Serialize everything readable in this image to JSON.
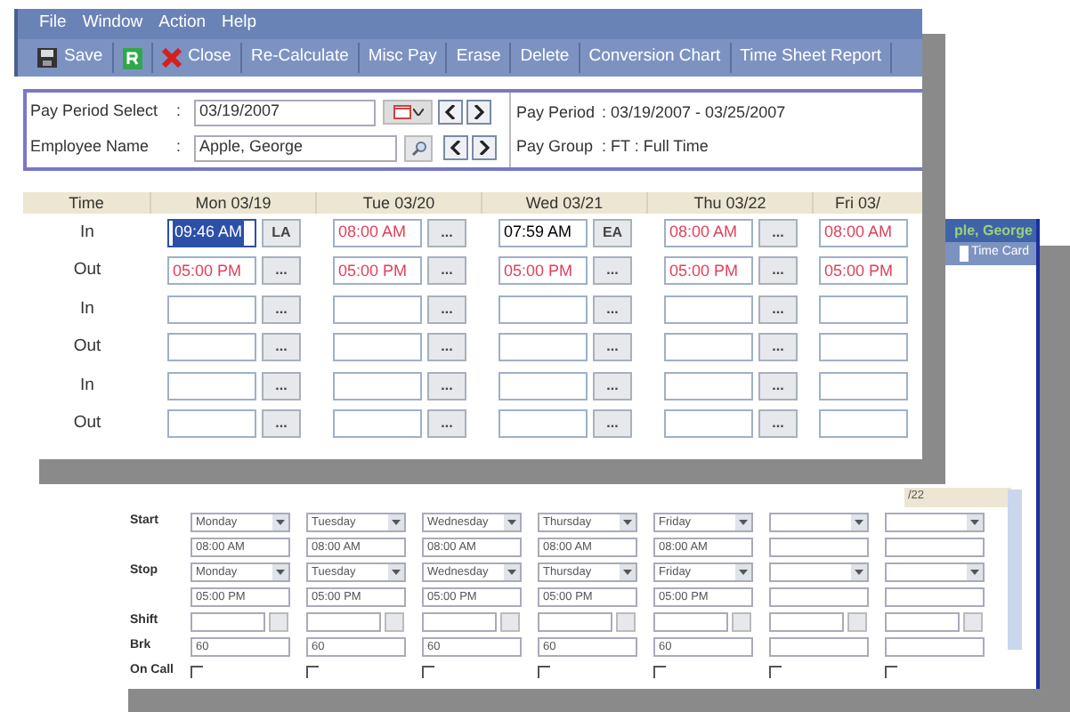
{
  "front_window": {
    "menu": [
      "File",
      "Window",
      "Action",
      "Help"
    ],
    "toolbar": [
      {
        "kind": "save",
        "label": "Save"
      },
      {
        "kind": "refresh"
      },
      {
        "kind": "close",
        "label": "Close"
      },
      {
        "kind": "text",
        "label": "Re-Calculate"
      },
      {
        "kind": "text",
        "label": "Misc Pay"
      },
      {
        "kind": "text",
        "label": "Erase"
      },
      {
        "kind": "text",
        "label": "Delete"
      },
      {
        "kind": "text",
        "label": "Conversion Chart"
      },
      {
        "kind": "text",
        "label": "Time Sheet Report"
      }
    ],
    "pay_period_select": {
      "label": "Pay Period Select",
      "colon": ":",
      "value": "03/19/2007"
    },
    "employee_name": {
      "label": "Employee Name",
      "colon": ":",
      "value": "Apple, George"
    },
    "pay_period": {
      "label": "Pay Period",
      "value": ": 03/19/2007 - 03/25/2007"
    },
    "pay_group": {
      "label": "Pay Group",
      "value": ": FT : Full Time"
    },
    "table": {
      "columns": [
        "Time",
        "Mon 03/19",
        "Tue 03/20",
        "Wed 03/21",
        "Thu 03/22",
        "Fri 03/"
      ],
      "rows": [
        {
          "label": "In",
          "cells": [
            {
              "kind": "actual",
              "value": "09:46 AM",
              "selected": true,
              "button": "LA"
            },
            {
              "kind": "scheduled",
              "value": "08:00 AM",
              "selected": false,
              "button": "..."
            },
            {
              "kind": "actual",
              "value": "07:59 AM",
              "selected": false,
              "button": "EA"
            },
            {
              "kind": "scheduled",
              "value": "08:00 AM",
              "selected": false,
              "button": "..."
            },
            {
              "kind": "scheduled",
              "value": "08:00 AM",
              "selected": false
            }
          ]
        },
        {
          "label": "Out",
          "cells": [
            {
              "kind": "scheduled",
              "value": "05:00 PM",
              "selected": false,
              "button": "..."
            },
            {
              "kind": "scheduled",
              "value": "05:00 PM",
              "selected": false,
              "button": "..."
            },
            {
              "kind": "scheduled",
              "value": "05:00 PM",
              "selected": false,
              "button": "..."
            },
            {
              "kind": "scheduled",
              "value": "05:00 PM",
              "selected": false,
              "button": "..."
            },
            {
              "kind": "scheduled",
              "value": "05:00 PM",
              "selected": false
            }
          ]
        },
        {
          "label": "In",
          "cells": [
            {
              "kind": "empty",
              "selected": false,
              "button": "..."
            },
            {
              "kind": "empty",
              "selected": false,
              "button": "..."
            },
            {
              "kind": "empty",
              "selected": false,
              "button": "..."
            },
            {
              "kind": "empty",
              "selected": false,
              "button": "..."
            },
            {
              "kind": "empty",
              "selected": false
            }
          ]
        },
        {
          "label": "Out",
          "cells": [
            {
              "kind": "empty",
              "selected": false,
              "button": "..."
            },
            {
              "kind": "empty",
              "selected": false,
              "button": "..."
            },
            {
              "kind": "empty",
              "selected": false,
              "button": "..."
            },
            {
              "kind": "empty",
              "selected": false,
              "button": "..."
            },
            {
              "kind": "empty",
              "selected": false
            }
          ]
        },
        {
          "label": "In",
          "cells": [
            {
              "kind": "empty",
              "selected": false,
              "button": "..."
            },
            {
              "kind": "empty",
              "selected": false,
              "button": "..."
            },
            {
              "kind": "empty",
              "selected": false,
              "button": "..."
            },
            {
              "kind": "empty",
              "selected": false,
              "button": "..."
            },
            {
              "kind": "empty",
              "selected": false
            }
          ]
        },
        {
          "label": "Out",
          "cells": [
            {
              "kind": "empty",
              "selected": false,
              "button": "..."
            },
            {
              "kind": "empty",
              "selected": false,
              "button": "..."
            },
            {
              "kind": "empty",
              "selected": false,
              "button": "..."
            },
            {
              "kind": "empty",
              "selected": false,
              "button": "..."
            },
            {
              "kind": "empty",
              "selected": false
            }
          ]
        }
      ]
    }
  },
  "back_window": {
    "employee": "ple, George",
    "toolbar_button": "Time Card",
    "column_header": "/22",
    "rows": [
      {
        "kind": "day",
        "label": "Start",
        "values": [
          "Monday",
          "Tuesday",
          "Wednesday",
          "Thursday",
          "Friday"
        ]
      },
      {
        "kind": "time",
        "values": [
          "08:00 AM",
          "08:00 AM",
          "08:00 AM",
          "08:00 AM",
          "08:00 AM"
        ]
      },
      {
        "kind": "day",
        "label": "Stop",
        "values": [
          "Monday",
          "Tuesday",
          "Wednesday",
          "Thursday",
          "Friday"
        ]
      },
      {
        "kind": "time",
        "values": [
          "05:00 PM",
          "05:00 PM",
          "05:00 PM",
          "05:00 PM",
          "05:00 PM"
        ]
      },
      {
        "kind": "lookup",
        "label": "Shift"
      },
      {
        "kind": "time",
        "label": "Brk",
        "values": [
          "60",
          "60",
          "60",
          "60",
          "60"
        ]
      },
      {
        "kind": "check",
        "label": "On Call",
        "checked": [
          false,
          false,
          false,
          false,
          false,
          false,
          false
        ]
      }
    ]
  }
}
